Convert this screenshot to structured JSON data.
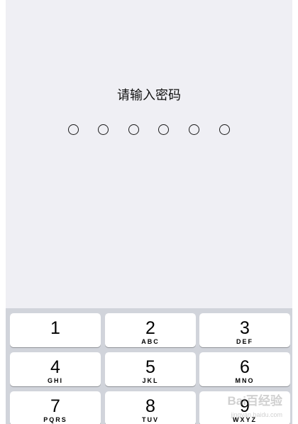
{
  "passcode": {
    "prompt": "请输入密码",
    "digit_count": 6,
    "entered": 0
  },
  "keypad": {
    "keys": [
      {
        "digit": "1",
        "letters": ""
      },
      {
        "digit": "2",
        "letters": "ABC"
      },
      {
        "digit": "3",
        "letters": "DEF"
      },
      {
        "digit": "4",
        "letters": "GHI"
      },
      {
        "digit": "5",
        "letters": "JKL"
      },
      {
        "digit": "6",
        "letters": "MNO"
      },
      {
        "digit": "7",
        "letters": "PQRS"
      },
      {
        "digit": "8",
        "letters": "TUV"
      },
      {
        "digit": "9",
        "letters": "WXYZ"
      }
    ]
  },
  "watermark": {
    "text": "Bai百经验",
    "sub": "jingyan.baidu.com"
  },
  "colors": {
    "background": "#efeff4",
    "keypad_background": "#d1d4db",
    "key": "#ffffff",
    "text": "#111111"
  }
}
